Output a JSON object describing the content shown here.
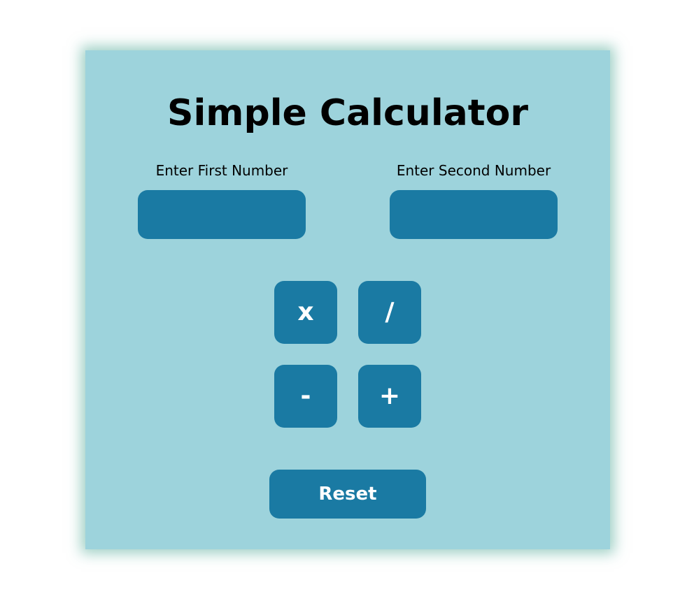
{
  "calculator": {
    "title": "Simple Calculator",
    "first_input": {
      "label": "Enter First Number",
      "value": "",
      "placeholder": ""
    },
    "second_input": {
      "label": "Enter Second Number",
      "value": "",
      "placeholder": ""
    },
    "operations": {
      "multiply": "x",
      "divide": "/",
      "subtract": "-",
      "add": "+"
    },
    "reset_label": "Reset"
  },
  "colors": {
    "page_background": "#ffffff",
    "card_background": "#9dd3dc",
    "control_background": "#1a7aa3",
    "control_text": "#ffffff",
    "text": "#000000",
    "card_glow": "#50aa96"
  }
}
